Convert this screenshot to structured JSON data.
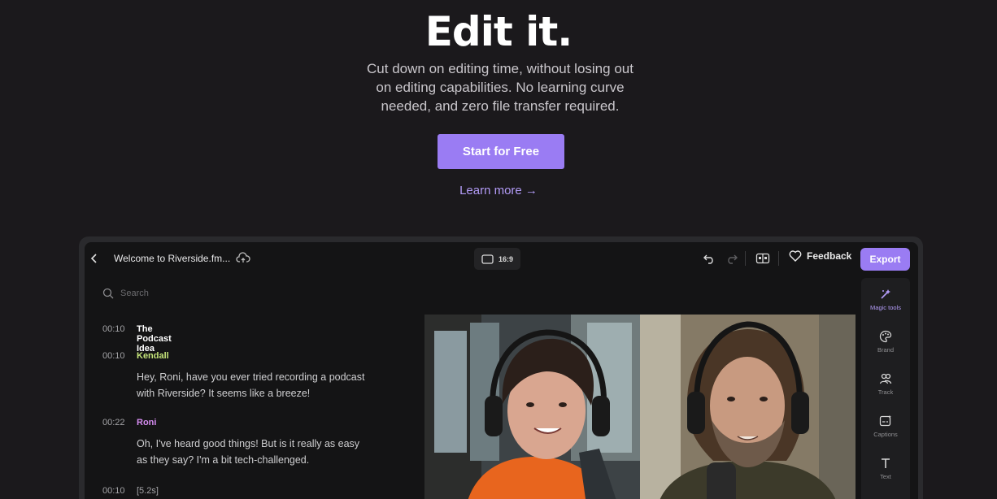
{
  "hero": {
    "title": "Edit it.",
    "subtitle_lines": [
      "Cut down on editing time, without losing out",
      "on editing capabilities. No learning curve",
      "needed, and zero file transfer required."
    ],
    "cta_label": "Start for Free",
    "learn_label": "Learn more →"
  },
  "editor": {
    "doc_title": "Welcome to Riverside.fm...",
    "aspect_ratio": "16:9",
    "feedback_label": "Feedback",
    "export_label": "Export",
    "search_placeholder": "Search",
    "transcript": [
      {
        "time": "00:10",
        "head": "The Podcast Idea",
        "head_color": "#ffffff",
        "text": []
      },
      {
        "time": "00:10",
        "head": "Kendall",
        "head_color": "#c6e57a",
        "text": [
          "Hey, Roni, have you ever tried recording a podcast",
          "with Riverside? It seems like a breeze!"
        ]
      },
      {
        "time": "00:22",
        "head": "Roni",
        "head_color": "#d58cf0",
        "text": [
          "Oh, I've heard good things! But is it really as easy",
          "as they say? I'm a bit tech-challenged."
        ]
      },
      {
        "time": "00:10",
        "head": "[5.2s]",
        "head_color": "#a3a3a6",
        "text": []
      }
    ],
    "rail": [
      {
        "label": "Magic tools",
        "icon": "magic-wand-icon"
      },
      {
        "label": "Brand",
        "icon": "palette-icon"
      },
      {
        "label": "Track",
        "icon": "users-icon"
      },
      {
        "label": "Captions",
        "icon": "captions-icon"
      },
      {
        "label": "Text",
        "icon": "text-icon"
      }
    ]
  },
  "colors": {
    "accent": "#9a7cf3",
    "link": "#b29bf6",
    "background": "#1b191c"
  }
}
